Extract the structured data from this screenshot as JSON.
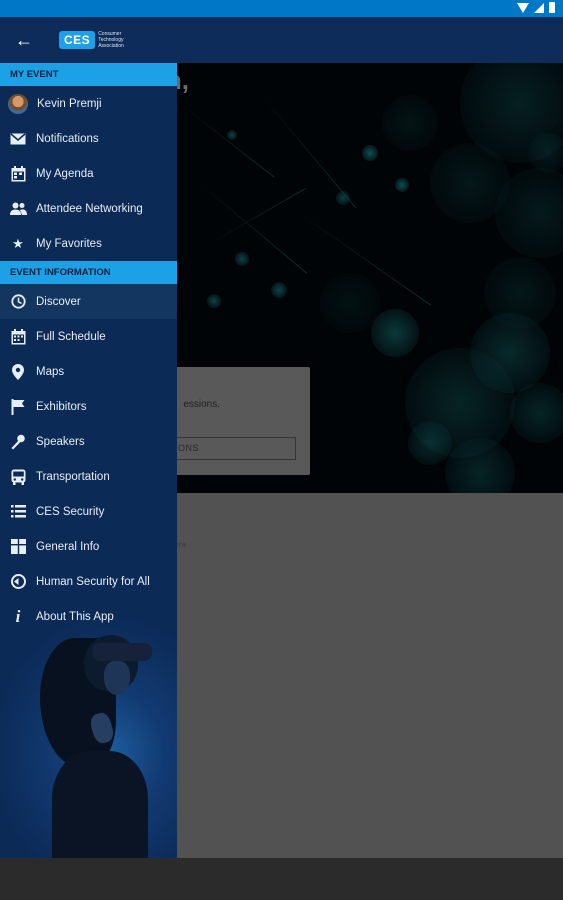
{
  "app": {
    "logo_text": "CES",
    "logo_subtitle": "Consumer Technology Association"
  },
  "main": {
    "greeting": "on,",
    "card_text": "essions.",
    "card_button": "SSIONS",
    "body_text": "here"
  },
  "drawer": {
    "my_event_header": "MY EVENT",
    "event_info_header": "EVENT INFORMATION",
    "my_event_items": [
      {
        "label": "Kevin Premji",
        "icon": "avatar"
      },
      {
        "label": "Notifications",
        "icon": "envelope-icon"
      },
      {
        "label": "My Agenda",
        "icon": "calendar-icon"
      },
      {
        "label": "Attendee Networking",
        "icon": "people-icon"
      },
      {
        "label": "My Favorites",
        "icon": "star-icon"
      }
    ],
    "event_info_items": [
      {
        "label": "Discover",
        "icon": "clock-icon",
        "active": true
      },
      {
        "label": "Full Schedule",
        "icon": "calendar-grid-icon"
      },
      {
        "label": "Maps",
        "icon": "map-pin-icon"
      },
      {
        "label": "Exhibitors",
        "icon": "flag-icon"
      },
      {
        "label": "Speakers",
        "icon": "microphone-icon"
      },
      {
        "label": "Transportation",
        "icon": "bus-icon"
      },
      {
        "label": "CES Security",
        "icon": "list-icon"
      },
      {
        "label": "General Info",
        "icon": "grid-icon"
      },
      {
        "label": "Human Security for All",
        "icon": "shield-icon"
      },
      {
        "label": "About This App",
        "icon": "info-icon"
      }
    ]
  },
  "colors": {
    "accent": "#1da1e6",
    "drawer_bg": "#0b2a56",
    "app_bar": "#0e2c5a",
    "status_bar": "#0078c8"
  }
}
